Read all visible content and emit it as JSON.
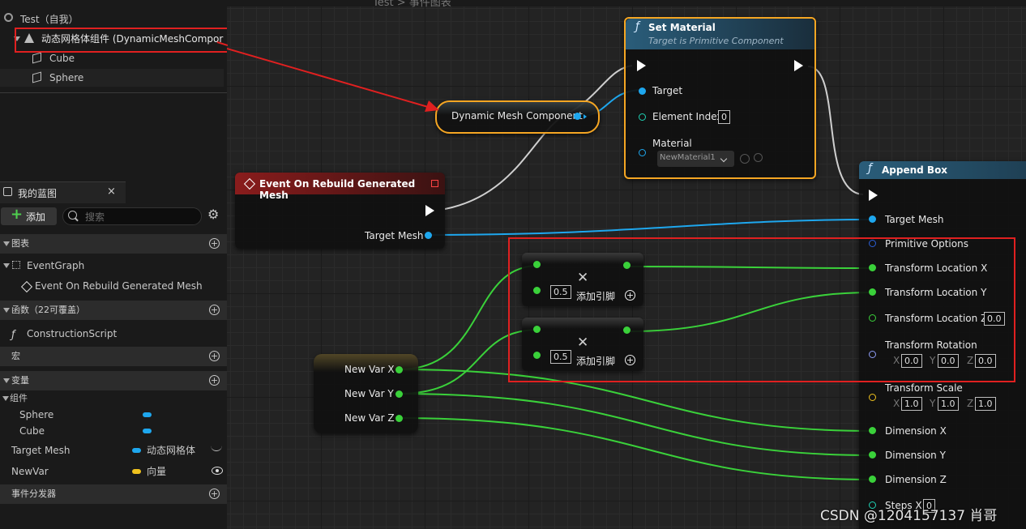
{
  "components": {
    "root": "Test（自我）",
    "dynamic_mesh": "动态网格体组件 (DynamicMeshCompor",
    "cube": "Cube",
    "sphere": "Sphere"
  },
  "my_blueprint": {
    "tab_title": "我的蓝图",
    "close": "×",
    "add_label": "添加",
    "search_placeholder": "搜索",
    "graphs_section": "图表",
    "event_graph": "EventGraph",
    "event_item": "Event On Rebuild Generated Mesh",
    "functions_section": "函数（22可覆盖）",
    "construction_script": "ConstructionScript",
    "macros_section": "宏",
    "variables_section": "变量",
    "components_group": "组件",
    "var_sphere": "Sphere",
    "var_cube": "Cube",
    "target_mesh_name": "Target Mesh",
    "target_mesh_type": "动态网格体",
    "newvar_name": "NewVar",
    "newvar_type": "向量",
    "dispatchers_section": "事件分发器"
  },
  "nodes": {
    "set_material": {
      "title": "Set Material",
      "subtitle": "Target is Primitive Component",
      "target": "Target",
      "element_index": "Element Index",
      "element_index_value": "0",
      "material": "Material",
      "material_value": "NewMaterial1"
    },
    "dynamic_mesh_component": "Dynamic Mesh Component",
    "event": {
      "title": "Event On Rebuild Generated Mesh",
      "target_mesh": "Target Mesh"
    },
    "multiply_1": {
      "value": "0.5",
      "add_pin": "添加引脚"
    },
    "multiply_2": {
      "value": "0.5",
      "add_pin": "添加引脚"
    },
    "break_vector": {
      "x": "New Var X",
      "y": "New Var Y",
      "z": "New Var Z"
    },
    "append_box": {
      "title": "Append Box",
      "target_mesh": "Target Mesh",
      "primitive_options": "Primitive Options",
      "loc_x": "Transform Location X",
      "loc_y": "Transform Location Y",
      "loc_z": "Transform Location Z",
      "loc_z_value": "0.0",
      "rotation": "Transform Rotation",
      "rot_x": "0.0",
      "rot_y": "0.0",
      "rot_z": "0.0",
      "scale": "Transform Scale",
      "scale_x": "1.0",
      "scale_y": "1.0",
      "scale_z": "1.0",
      "axis_x": "X",
      "axis_y": "Y",
      "axis_z": "Z",
      "dim_x": "Dimension X",
      "dim_y": "Dimension Y",
      "dim_z": "Dimension Z",
      "steps_x": "Steps X",
      "steps_x_value": "0"
    }
  },
  "breadcrumb": "Test > 事件图表",
  "watermark": "CSDN @1204157137 肖哥",
  "colors": {
    "exec": "#ffffff",
    "object_pin": "#1ea7ee",
    "float_pin": "#3ad13a",
    "struct_pin": "#2c5fd6",
    "vector_pin": "#f0c21e",
    "rotator_pin": "#8e9cf5",
    "highlight": "#e02020",
    "node_selected": "#f5a623"
  }
}
